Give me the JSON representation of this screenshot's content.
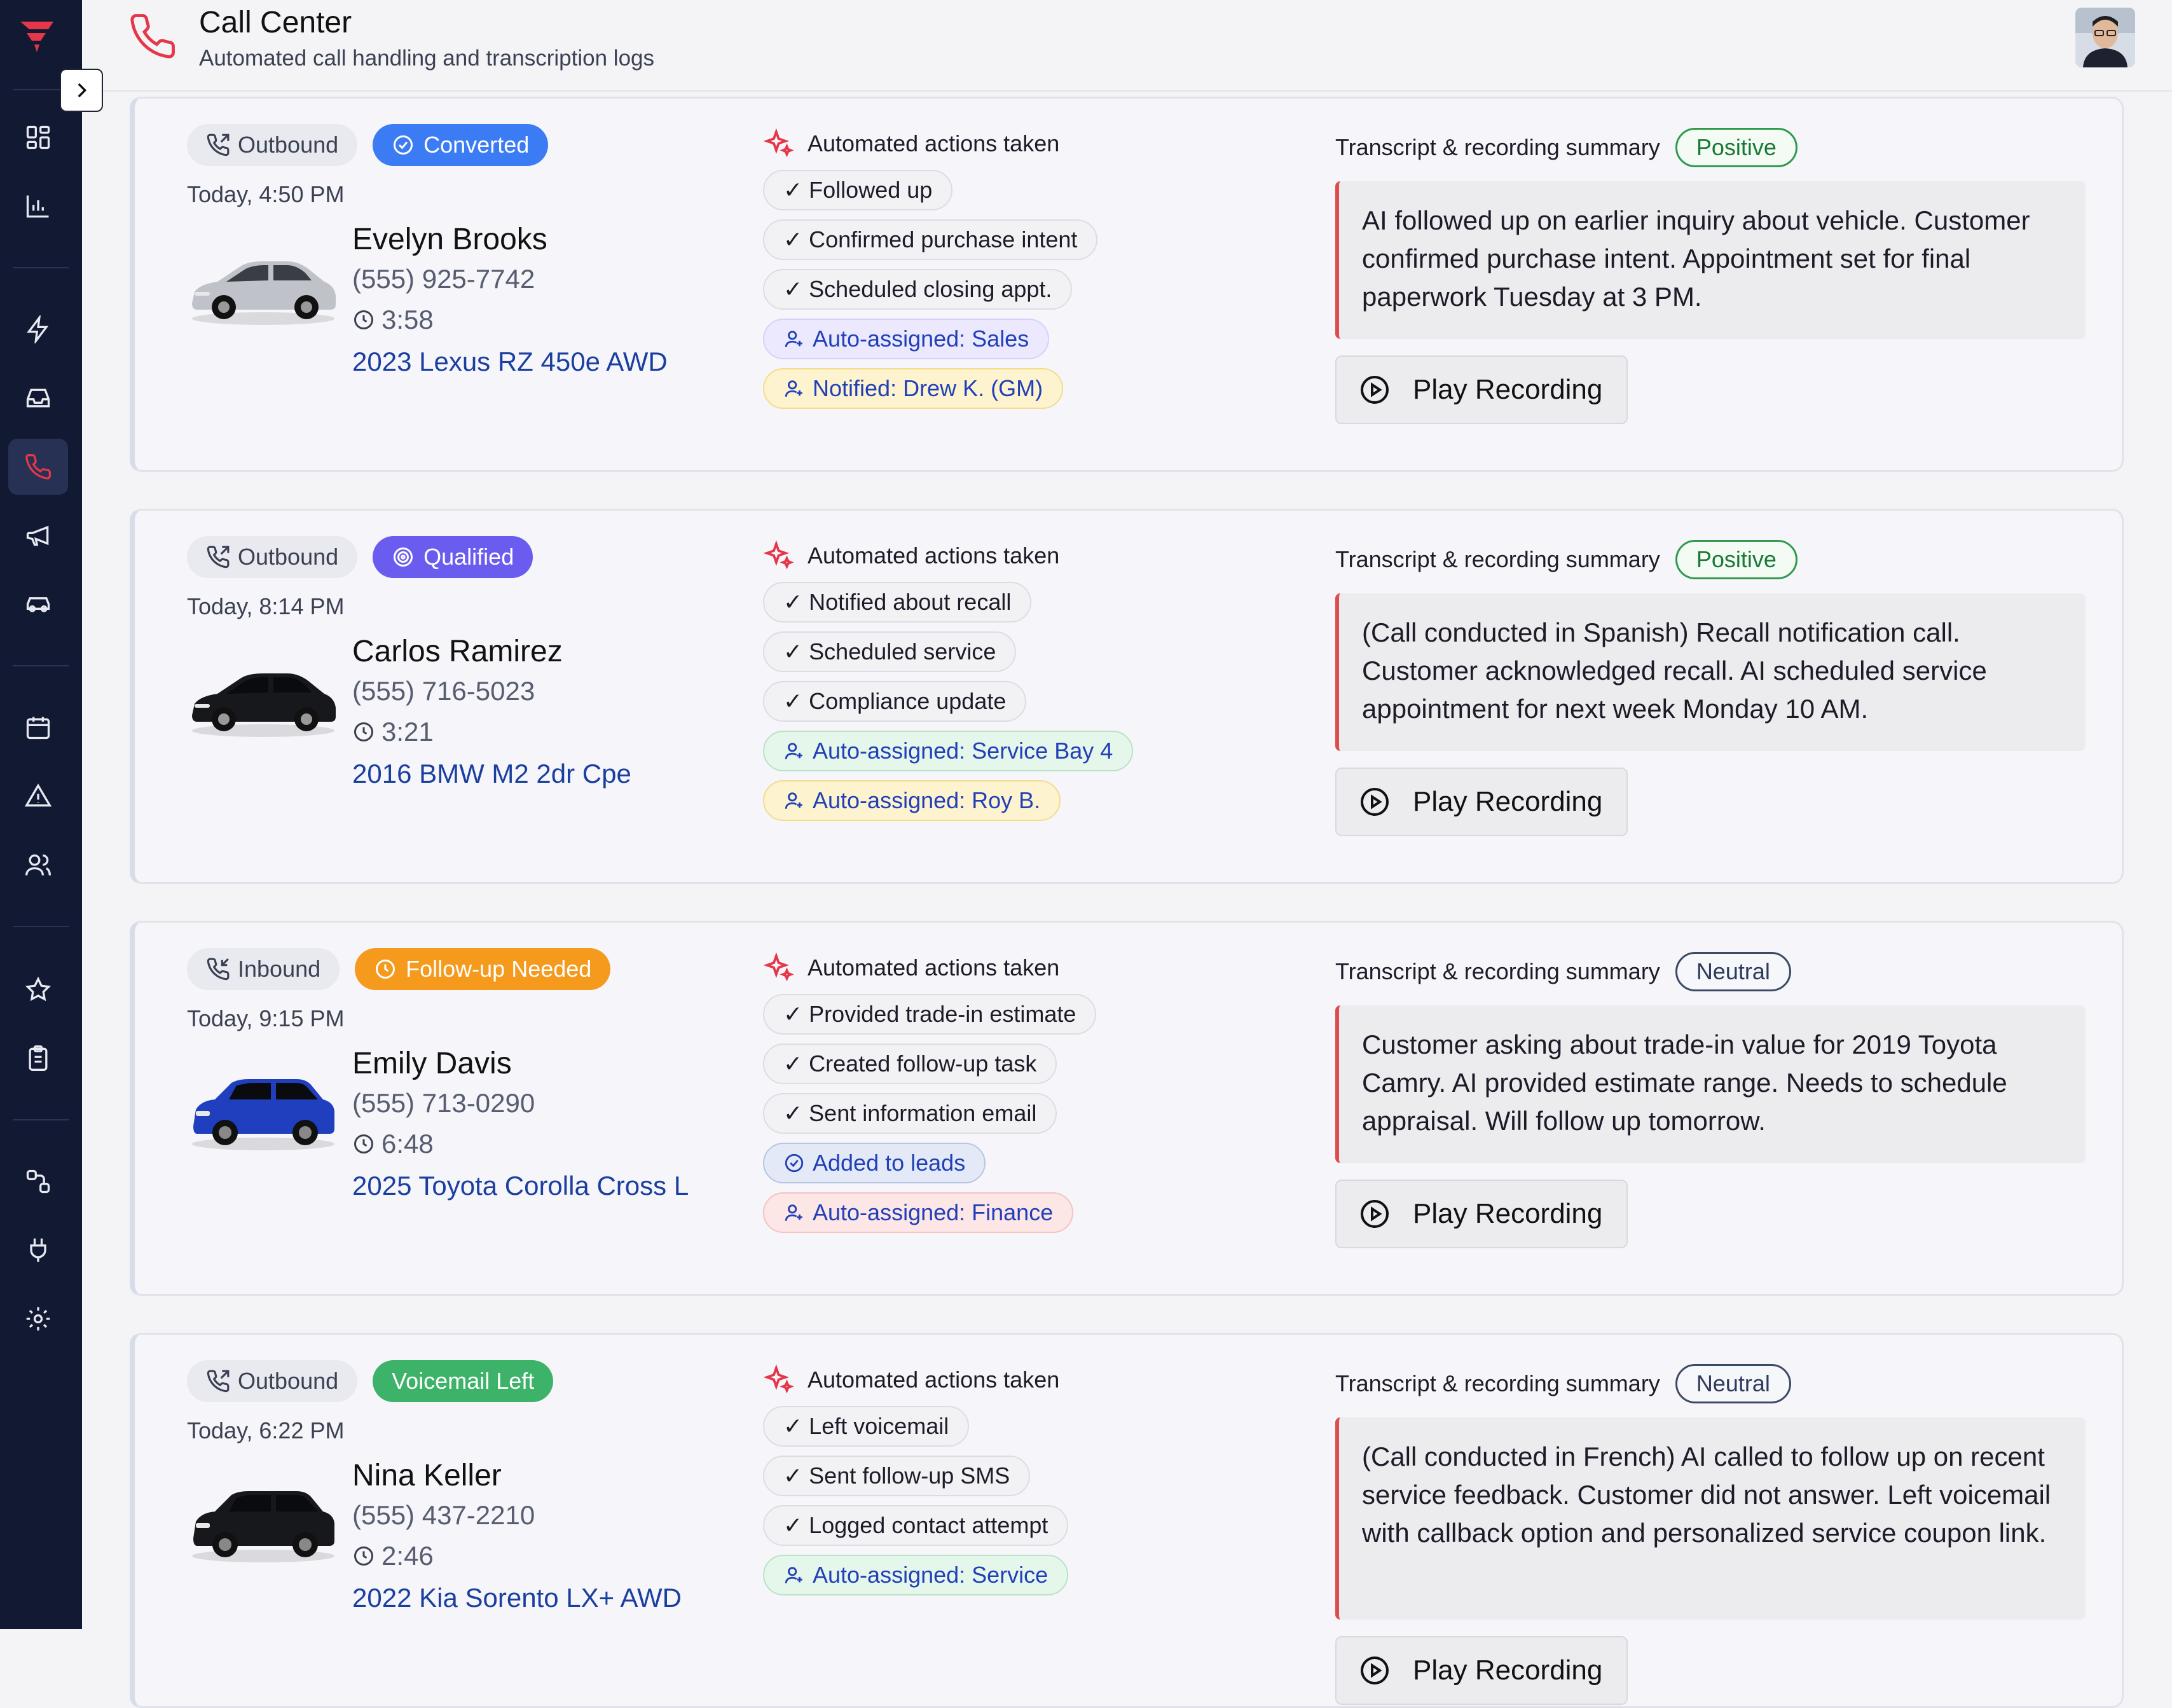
{
  "header": {
    "title": "Call Center",
    "subtitle": "Automated call handling and transcription logs"
  },
  "colors": {
    "sidebar_bg": "#121a33",
    "accent_red": "#e5364a",
    "converted": "#3b7cf5",
    "qualified": "#6b5cf0",
    "follow_up": "#f59a1c",
    "voicemail": "#3db36a"
  },
  "sidebar": {
    "icons": [
      "dashboard-icon",
      "bar-chart-icon",
      "lightning-icon",
      "inbox-icon",
      "phone-icon",
      "megaphone-icon",
      "car-icon",
      "calendar-icon",
      "warning-icon",
      "users-icon",
      "star-icon",
      "clipboard-icon",
      "workflow-icon",
      "plug-icon",
      "gear-icon"
    ],
    "active": "phone-icon"
  },
  "labels": {
    "actions_heading": "Automated actions taken",
    "summary_heading": "Transcript & recording summary",
    "play_recording": "Play Recording"
  },
  "calls": [
    {
      "direction": "Outbound",
      "status": "Converted",
      "time": "Today, 4:50 PM",
      "name": "Evelyn Brooks",
      "phone": "(555) 925-7742",
      "duration": "3:58",
      "vehicle": "2023 Lexus RZ 450e AWD",
      "car_color": "silver",
      "actions": [
        "✓ Followed up",
        "✓ Confirmed purchase intent",
        "✓ Scheduled closing appt."
      ],
      "assignments": [
        "Auto-assigned: Sales",
        "Notified: Drew K. (GM)"
      ],
      "sentiment": "Positive",
      "summary": "AI followed up on earlier inquiry about vehicle. Customer confirmed purchase intent. Appointment set for final paperwork Tuesday at 3 PM."
    },
    {
      "direction": "Outbound",
      "status": "Qualified",
      "time": "Today, 8:14 PM",
      "name": "Carlos Ramirez",
      "phone": "(555) 716-5023",
      "duration": "3:21",
      "vehicle": "2016 BMW M2 2dr Cpe",
      "car_color": "black",
      "actions": [
        "✓ Notified about recall",
        "✓ Scheduled service",
        "✓ Compliance update"
      ],
      "assignments": [
        "Auto-assigned: Service Bay 4",
        "Auto-assigned: Roy B."
      ],
      "sentiment": "Positive",
      "summary": "(Call conducted in Spanish) Recall notification call. Customer acknowledged recall. AI scheduled service appointment for next week Monday 10 AM."
    },
    {
      "direction": "Inbound",
      "status": "Follow-up Needed",
      "time": "Today, 9:15 PM",
      "name": "Emily Davis",
      "phone": "(555) 713-0290",
      "duration": "6:48",
      "vehicle": "2025 Toyota Corolla Cross L",
      "car_color": "blue",
      "actions": [
        "✓ Provided trade-in estimate",
        "✓ Created follow-up task",
        "✓ Sent information email"
      ],
      "assignments": [
        "Added to leads",
        "Auto-assigned: Finance"
      ],
      "sentiment": "Neutral",
      "summary": "Customer asking about trade-in value for 2019 Toyota Camry. AI provided estimate range. Needs to schedule appraisal. Will follow up tomorrow."
    },
    {
      "direction": "Outbound",
      "status": "Voicemail Left",
      "time": "Today, 6:22 PM",
      "name": "Nina Keller",
      "phone": "(555) 437-2210",
      "duration": "2:46",
      "vehicle": "2022 Kia Sorento LX+ AWD",
      "car_color": "black",
      "actions": [
        "✓ Left voicemail",
        "✓ Sent follow-up SMS",
        "✓ Logged contact attempt"
      ],
      "assignments": [
        "Auto-assigned: Service"
      ],
      "sentiment": "Neutral",
      "summary": "(Call conducted in French) AI called to follow up on recent service feedback. Customer did not answer. Left voicemail with callback option and personalized service coupon link."
    }
  ]
}
